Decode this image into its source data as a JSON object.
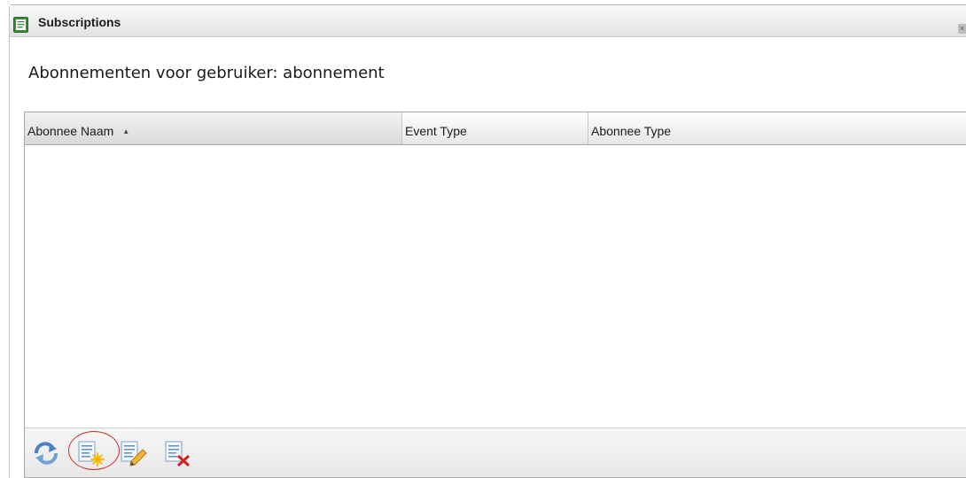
{
  "window": {
    "title": "Subscriptions",
    "close_label": "×"
  },
  "heading": "Abonnementen voor gebruiker: abonnement",
  "grid": {
    "columns": [
      {
        "label": "Abonnee Naam",
        "sort": "ascending"
      },
      {
        "label": "Event Type"
      },
      {
        "label": "Abonnee Type"
      }
    ],
    "sort_glyph": "▲",
    "rows": []
  },
  "toolbar": {
    "buttons": [
      {
        "icon": "refresh-icon"
      },
      {
        "icon": "add-subscription-icon",
        "highlighted": true
      },
      {
        "icon": "edit-subscription-icon"
      },
      {
        "icon": "delete-subscription-icon"
      }
    ]
  },
  "colors": {
    "highlight_ring": "#d0302b",
    "icon_blue": "#5a8fd0",
    "title_icon_green": "#3a8a3a"
  }
}
